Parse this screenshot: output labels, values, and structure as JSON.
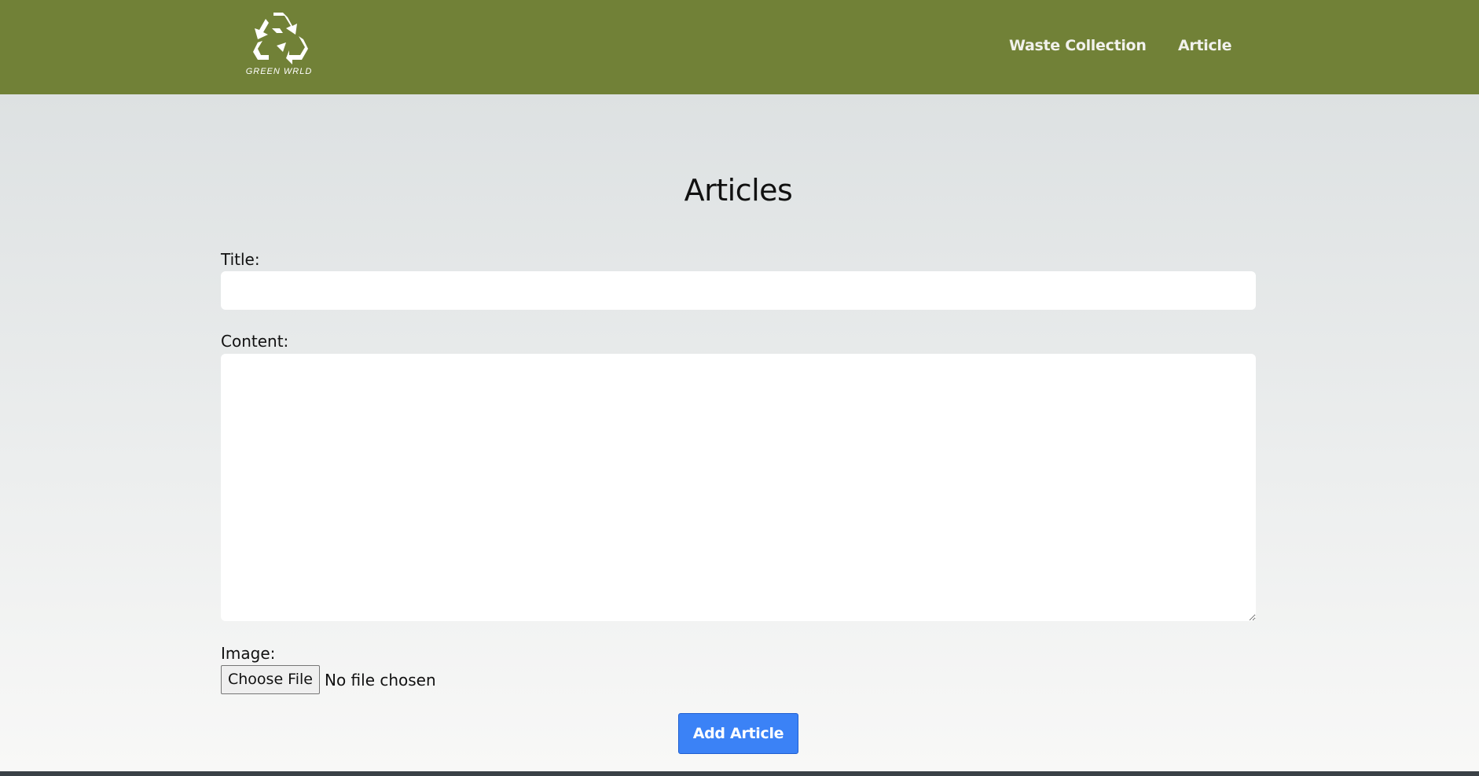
{
  "header": {
    "logo_icon": "recycle-icon",
    "logo_text": "GREEN WRLD",
    "nav": [
      {
        "label": "Waste Collection"
      },
      {
        "label": "Article"
      }
    ]
  },
  "main": {
    "title": "Articles",
    "form": {
      "title_label": "Title:",
      "title_value": "",
      "content_label": "Content:",
      "content_value": "",
      "image_label": "Image:",
      "file_button_label": "Choose File",
      "file_status": "No file chosen",
      "submit_label": "Add Article"
    }
  },
  "colors": {
    "nav_background": "#718137",
    "nav_text": "#f1f1ec",
    "submit_button": "#3b82f6",
    "logo": "#ffffff"
  }
}
